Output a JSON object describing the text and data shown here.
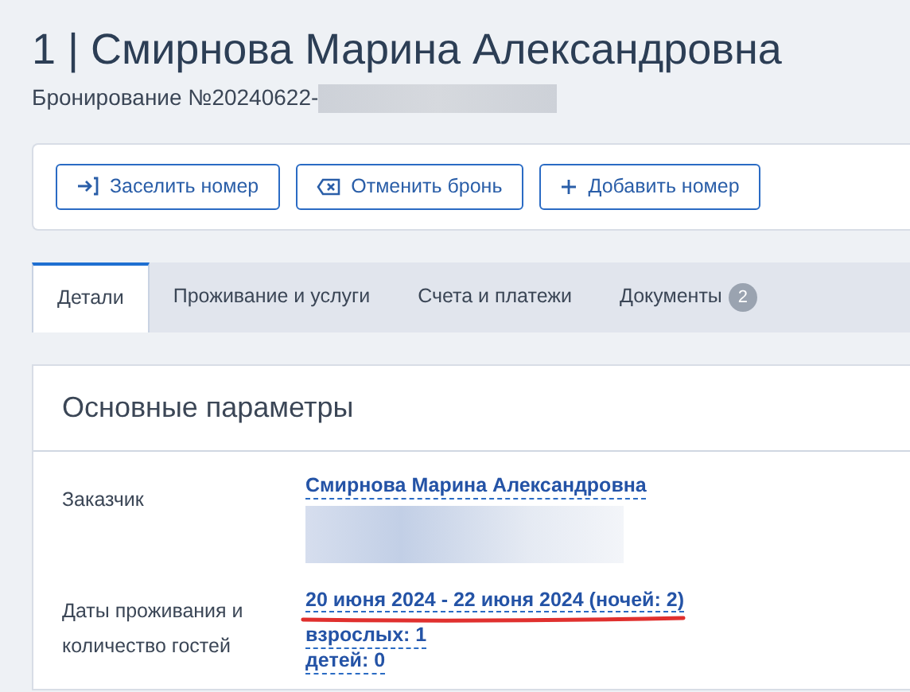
{
  "header": {
    "number": "1",
    "separator": "|",
    "guest_name": "Смирнова Марина Александровна",
    "booking": "Бронирование №20240622-"
  },
  "actions": [
    {
      "kind": "check-in",
      "label": "Заселить номер"
    },
    {
      "kind": "cancel",
      "label": "Отменить бронь"
    },
    {
      "kind": "add",
      "label": "Добавить номер"
    }
  ],
  "tabs": [
    {
      "label": "Детали",
      "selected": true
    },
    {
      "label": "Проживание и услуги",
      "selected": false
    },
    {
      "label": "Счета и платежи",
      "selected": false
    },
    {
      "label": "Документы",
      "selected": false,
      "badge": "2"
    }
  ],
  "section": {
    "title": "Основные параметры",
    "fields": [
      {
        "label": "Заказчик",
        "values": [
          "Смирнова Марина Александровна"
        ],
        "redacted": true,
        "highlighted": false
      },
      {
        "label": "Даты проживания и количество гостей",
        "values": [
          "20 июня 2024 - 22 июня 2024 (ночей: 2)",
          "взрослых: 1",
          "детей: 0"
        ],
        "redacted": false,
        "highlighted": true
      }
    ]
  }
}
